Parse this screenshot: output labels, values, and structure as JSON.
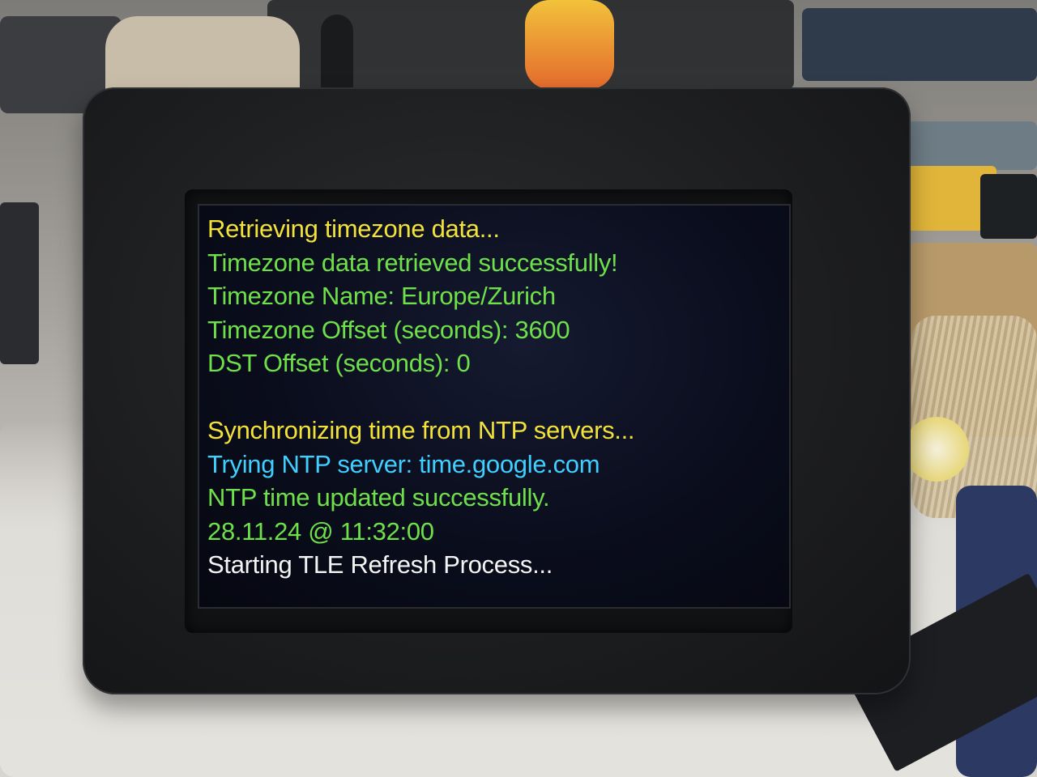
{
  "screen": {
    "lines": [
      {
        "text": "Retrieving timezone data...",
        "color": "#f2e23a"
      },
      {
        "text": "Timezone data retrieved successfully!",
        "color": "#6ee04a"
      },
      {
        "text": "Timezone Name: Europe/Zurich",
        "color": "#6ee04a"
      },
      {
        "text": "Timezone Offset (seconds): 3600",
        "color": "#6ee04a"
      },
      {
        "text": "DST Offset (seconds): 0",
        "color": "#6ee04a"
      },
      {
        "text": "",
        "color": "#6ee04a"
      },
      {
        "text": "Synchronizing time from NTP servers...",
        "color": "#f2e23a"
      },
      {
        "text": "Trying NTP server: time.google.com",
        "color": "#3fd0ff"
      },
      {
        "text": "NTP time updated successfully.",
        "color": "#6ee04a"
      },
      {
        "text": "28.11.24 @ 11:32:00",
        "color": "#6ee04a"
      },
      {
        "text": "Starting TLE Refresh Process...",
        "color": "#f4f4f4"
      }
    ]
  },
  "colors": {
    "case": "#1c1d1f",
    "screen_background": "#0a0d1c"
  }
}
